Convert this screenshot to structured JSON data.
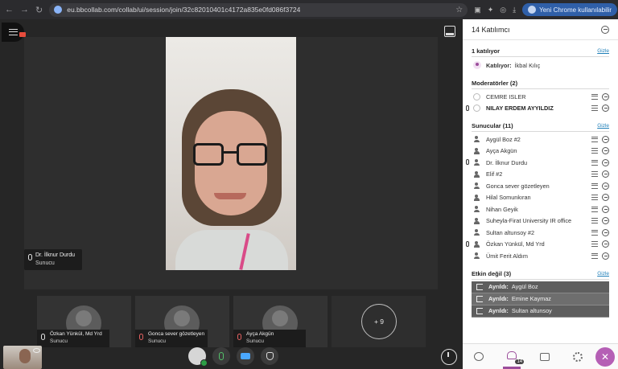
{
  "browser": {
    "url": "eu.bbcollab.com/collab/ui/session/join/32c82010401c4172a835e0fd086f3724",
    "profile_label": "Yeni Chrome kullanılabilir"
  },
  "stage": {
    "main_speaker": {
      "name": "Dr. İlknur Durdu",
      "role": "Sunucu"
    },
    "tiles": [
      {
        "name": "Özkan Yünkül, Md Yrd",
        "role": "Sunucu"
      },
      {
        "name": "Gonca sever gözetleyen",
        "role": "Sunucu"
      },
      {
        "name": "Ayça Akgün",
        "role": "Sunucu"
      }
    ],
    "more_count": "+ 9"
  },
  "panel": {
    "title": "14 Katılımcı",
    "attending_section": {
      "title": "1 katılıyor",
      "link": "Gizle",
      "label": "Katılıyor:",
      "name": "İkbal Kılıç"
    },
    "moderators": {
      "title": "Moderatörler (2)",
      "items": [
        {
          "name": "CEMRE ISLER"
        },
        {
          "name": "NILAY ERDEM AYYILDIZ"
        }
      ]
    },
    "presenters": {
      "title": "Sunucular (11)",
      "link": "Gizle",
      "items": [
        {
          "name": "Aygül Boz #2"
        },
        {
          "name": "Ayça Akgün"
        },
        {
          "name": "Dr. İlknur Durdu"
        },
        {
          "name": "Elif #2"
        },
        {
          "name": "Gonca sever gözetleyen"
        },
        {
          "name": "Hilal Somunkıran"
        },
        {
          "name": "Nihan Geyik"
        },
        {
          "name": "Suheyla-Firat University IR office"
        },
        {
          "name": "Sultan altunsoy #2"
        },
        {
          "name": "Özkan Yünkül, Md Yrd"
        },
        {
          "name": "Ümit Ferit Aldım"
        }
      ]
    },
    "inactive": {
      "title": "Etkin değil (3)",
      "link": "Gizle",
      "left_label": "Ayrıldı:",
      "items": [
        {
          "name": "Aygül Boz"
        },
        {
          "name": "Emine Kaymaz"
        },
        {
          "name": "Sultan altunsoy"
        }
      ]
    },
    "nav": {
      "participant_count": "14"
    }
  }
}
